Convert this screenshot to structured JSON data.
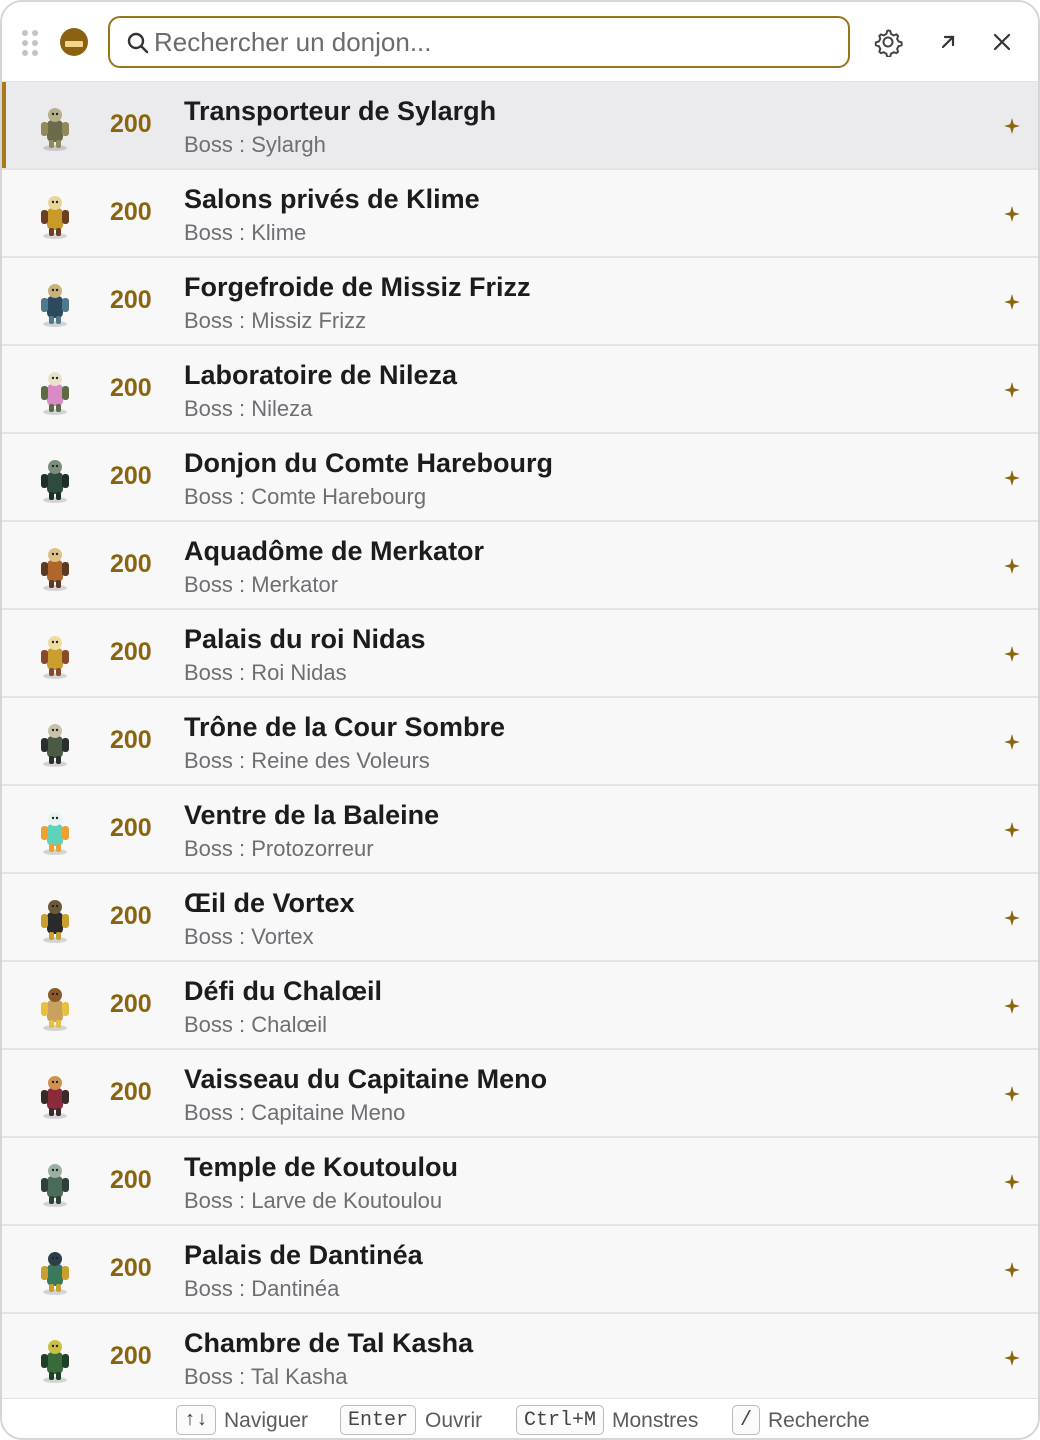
{
  "search": {
    "placeholder": "Rechercher un donjon..."
  },
  "colors": {
    "accent": "#8b6410",
    "selected_bg": "#ebebed"
  },
  "dungeons": [
    {
      "level": "200",
      "name": "Transporteur de Sylargh",
      "boss": "Boss : Sylargh",
      "selected": true,
      "palette": [
        "#6b6a4a",
        "#8d8a5c",
        "#b5b08a"
      ]
    },
    {
      "level": "200",
      "name": "Salons privés de Klime",
      "boss": "Boss : Klime",
      "palette": [
        "#c99a2a",
        "#6b3f1f",
        "#e8d59b"
      ]
    },
    {
      "level": "200",
      "name": "Forgefroide de Missiz Frizz",
      "boss": "Boss : Missiz Frizz",
      "palette": [
        "#2d4a5c",
        "#4f7a8a",
        "#c9b27a"
      ]
    },
    {
      "level": "200",
      "name": "Laboratoire de Nileza",
      "boss": "Boss : Nileza",
      "palette": [
        "#d88bc7",
        "#5d6b45",
        "#e8e2c8"
      ]
    },
    {
      "level": "200",
      "name": "Donjon du Comte Harebourg",
      "boss": "Boss : Comte Harebourg",
      "palette": [
        "#2f4a3e",
        "#1f2f28",
        "#7a8f7a"
      ]
    },
    {
      "level": "200",
      "name": "Aquadôme de Merkator",
      "boss": "Boss : Merkator",
      "palette": [
        "#b0652a",
        "#5a3a22",
        "#e0c08a"
      ]
    },
    {
      "level": "200",
      "name": "Palais du roi Nidas",
      "boss": "Boss : Roi Nidas",
      "palette": [
        "#c9a030",
        "#8a4a2a",
        "#f0dca0"
      ]
    },
    {
      "level": "200",
      "name": "Trône de la Cour Sombre",
      "boss": "Boss : Reine des Voleurs",
      "palette": [
        "#4a5a45",
        "#2a2f2a",
        "#c9c2a8"
      ]
    },
    {
      "level": "200",
      "name": "Ventre de la Baleine",
      "boss": "Boss : Protozorreur",
      "palette": [
        "#5ed3b8",
        "#f0a030",
        "#e8f5ee"
      ]
    },
    {
      "level": "200",
      "name": "Œil de Vortex",
      "boss": "Boss : Vortex",
      "palette": [
        "#2a2a2a",
        "#c9a030",
        "#6b5a3a"
      ]
    },
    {
      "level": "200",
      "name": "Défi du Chalœil",
      "boss": "Boss : Chalœil",
      "palette": [
        "#c9a060",
        "#e8c040",
        "#8a5a2a"
      ]
    },
    {
      "level": "200",
      "name": "Vaisseau du Capitaine Meno",
      "boss": "Boss : Capitaine Meno",
      "palette": [
        "#8a2a3a",
        "#3a2a2a",
        "#d09050"
      ]
    },
    {
      "level": "200",
      "name": "Temple de Koutoulou",
      "boss": "Boss : Larve de Koutoulou",
      "palette": [
        "#4a6a5a",
        "#2f3f3a",
        "#9ab0a0"
      ]
    },
    {
      "level": "200",
      "name": "Palais de Dantinéa",
      "boss": "Boss : Dantinéa",
      "palette": [
        "#3a7a5a",
        "#c9a030",
        "#2a3f4a"
      ]
    },
    {
      "level": "200",
      "name": "Chambre de Tal Kasha",
      "boss": "Boss : Tal Kasha",
      "palette": [
        "#3a6a3a",
        "#1f3f2a",
        "#c9c040"
      ]
    }
  ],
  "footer": {
    "shortcuts": [
      {
        "key": "↑↓",
        "label": "Naviguer"
      },
      {
        "key": "Enter",
        "label": "Ouvrir"
      },
      {
        "key": "Ctrl+M",
        "label": "Monstres"
      },
      {
        "key": "/",
        "label": "Recherche"
      }
    ]
  }
}
